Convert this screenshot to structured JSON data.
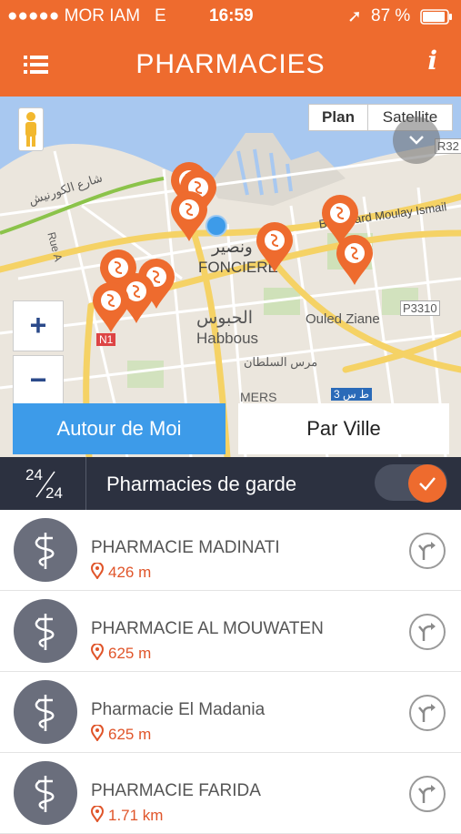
{
  "status_bar": {
    "carrier": "●●●●● MOR IAM",
    "network": "E",
    "time": "16:59",
    "location_arrow": "➚",
    "battery": "87 %"
  },
  "header": {
    "title": "PHARMACIES",
    "menu_icon": "list-icon",
    "info_icon": "info-icon",
    "info_label": "i"
  },
  "map": {
    "map_type_plan": "Plan",
    "map_type_satellite": "Satellite",
    "zoom_in": "+",
    "zoom_out": "−",
    "labels": {
      "corniche_ar": "شارع الكورنيش",
      "rue_a": "Rue A",
      "boulevard": "Boulevard Moulay Ismail",
      "foncier_ar": "ونصير",
      "fonciere": "FONCIERE",
      "habbous_ar": "الحبوس",
      "habbous": "Habbous",
      "ouled_ziane": "Ouled Ziane",
      "mers_ar": "مرس السلطان",
      "mers": "MERS",
      "r32": "R32",
      "p3310": "P3310",
      "n1": "N1",
      "ts3": "ط س 3"
    },
    "accent": "#ee6b2e",
    "location_color": "#3d9be9"
  },
  "segment": {
    "autour_label": "Autour de Moi",
    "ville_label": "Par Ville"
  },
  "garde_bar": {
    "counter_top": "24",
    "counter_bottom": "24",
    "label": "Pharmacies de garde",
    "toggle_on": true
  },
  "pharmacies": [
    {
      "name": "PHARMACIE MADINATI",
      "distance": "426 m"
    },
    {
      "name": "PHARMACIE AL MOUWATEN",
      "distance": "625 m"
    },
    {
      "name": "Pharmacie El Madania",
      "distance": "625 m"
    },
    {
      "name": "PHARMACIE FARIDA",
      "distance": "1.71 km"
    }
  ]
}
